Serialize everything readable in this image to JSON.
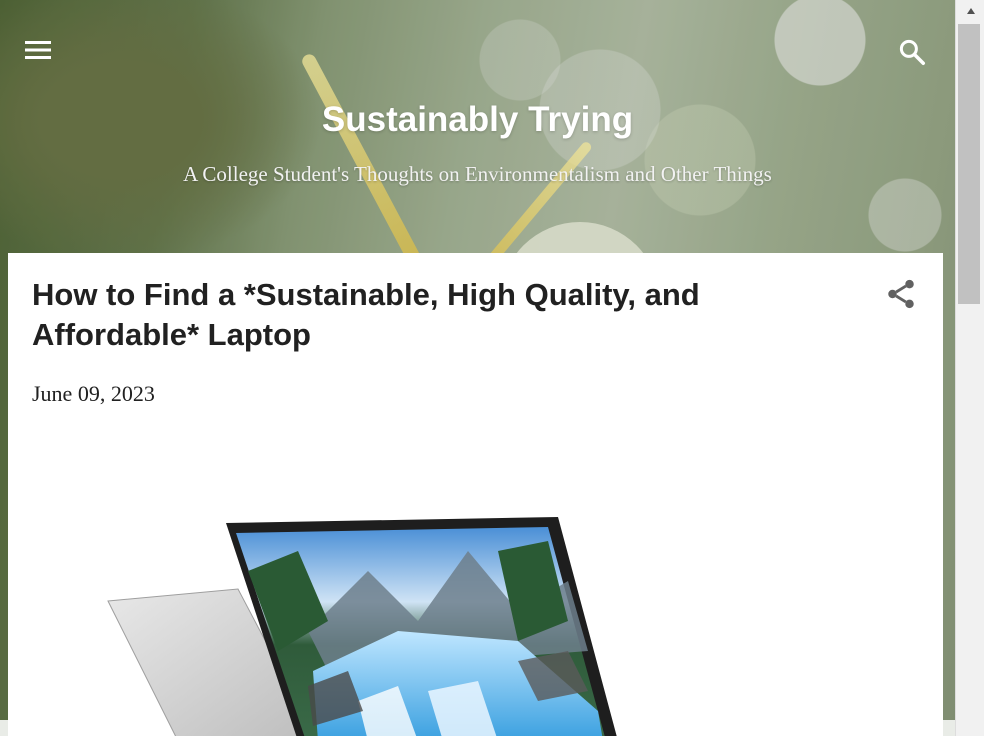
{
  "header": {
    "blog_title": "Sustainably Trying",
    "blog_description": "A College Student's Thoughts on Environmentalism and Other Things",
    "menu_icon": "hamburger-menu-icon",
    "search_icon": "search-icon"
  },
  "post": {
    "title": "How to Find a *Sustainable, High Quality, and Affordable* Laptop",
    "date": "June 09, 2023",
    "share_icon": "share-icon",
    "image_alt": "laptop with waterfall wallpaper"
  },
  "colors": {
    "title_text": "#212121",
    "header_text": "#ffffff",
    "card_bg": "#ffffff"
  }
}
